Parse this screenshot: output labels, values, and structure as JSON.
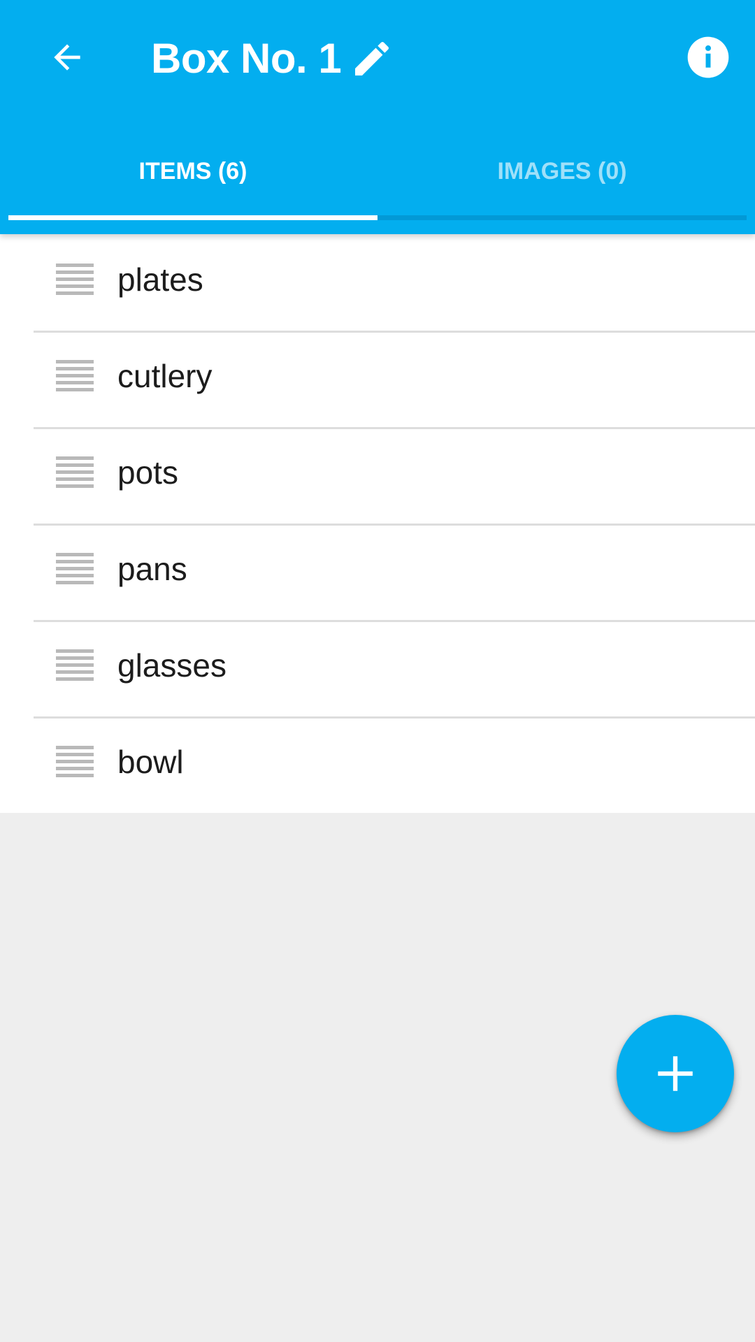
{
  "app_bar": {
    "title": "Box No. 1",
    "back_icon": "arrow-back-icon",
    "edit_icon": "pencil-icon",
    "info_icon": "info-icon",
    "background_color": "#03aeef"
  },
  "tabs": [
    {
      "label": "ITEMS (6)",
      "selected": true
    },
    {
      "label": "IMAGES (0)",
      "selected": false
    }
  ],
  "items": [
    {
      "label": "plates"
    },
    {
      "label": "cutlery"
    },
    {
      "label": "pots"
    },
    {
      "label": "pans"
    },
    {
      "label": "glasses"
    },
    {
      "label": "bowl"
    }
  ],
  "fab": {
    "icon": "plus-icon",
    "color": "#03aeef"
  }
}
